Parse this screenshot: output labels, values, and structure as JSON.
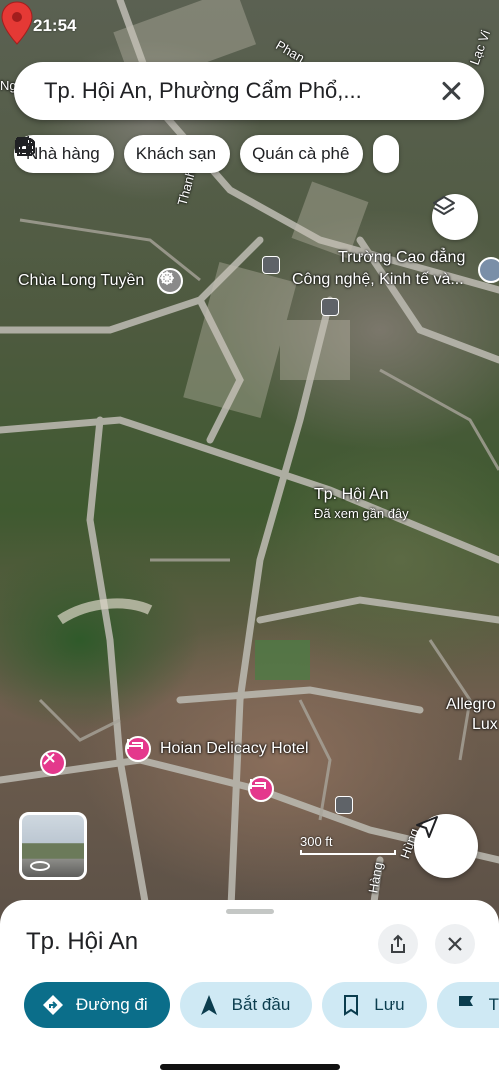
{
  "status": {
    "time": "21:54"
  },
  "search": {
    "text": "Tp. Hội An, Phường Cẩm Phổ,..."
  },
  "chips": [
    {
      "label": "Nhà hàng",
      "icon": "restaurant-icon"
    },
    {
      "label": "Khách sạn",
      "icon": "hotel-icon"
    },
    {
      "label": "Quán cà phê",
      "icon": "cafe-icon"
    },
    {
      "label": "",
      "icon": "gas-station-icon"
    }
  ],
  "map": {
    "labels": {
      "temple": "Chùa Long Tuyền",
      "college_1": "Trường Cao đẳng",
      "college_2": "Công nghệ, Kinh tế và...",
      "pin_title": "Tp. Hội An",
      "pin_subtitle": "Đã xem gần đây",
      "hotel": "Hoian Delicacy Hotel",
      "allegro_1": "Allegro",
      "allegro_2": "Lux",
      "road_top": "Phan",
      "road_left": "Thanh",
      "road_bottom": "Hùng",
      "road_bottom2": "Hàng",
      "road_right": "Lạc Vi",
      "edge_left": "Ng"
    },
    "scale": "300 ft"
  },
  "place": {
    "title": "Tp. Hội An",
    "actions": [
      {
        "label": "Đường đi",
        "icon": "directions-icon"
      },
      {
        "label": "Bắt đầu",
        "icon": "navigation-arrow-icon"
      },
      {
        "label": "Lưu",
        "icon": "bookmark-icon"
      },
      {
        "label": "T",
        "icon": "flag-icon"
      }
    ]
  },
  "colors": {
    "primary": "#0b6e8a",
    "secondary": "#cfe9f4",
    "pin": "#e53935",
    "hotel_poi": "#e4388c"
  }
}
